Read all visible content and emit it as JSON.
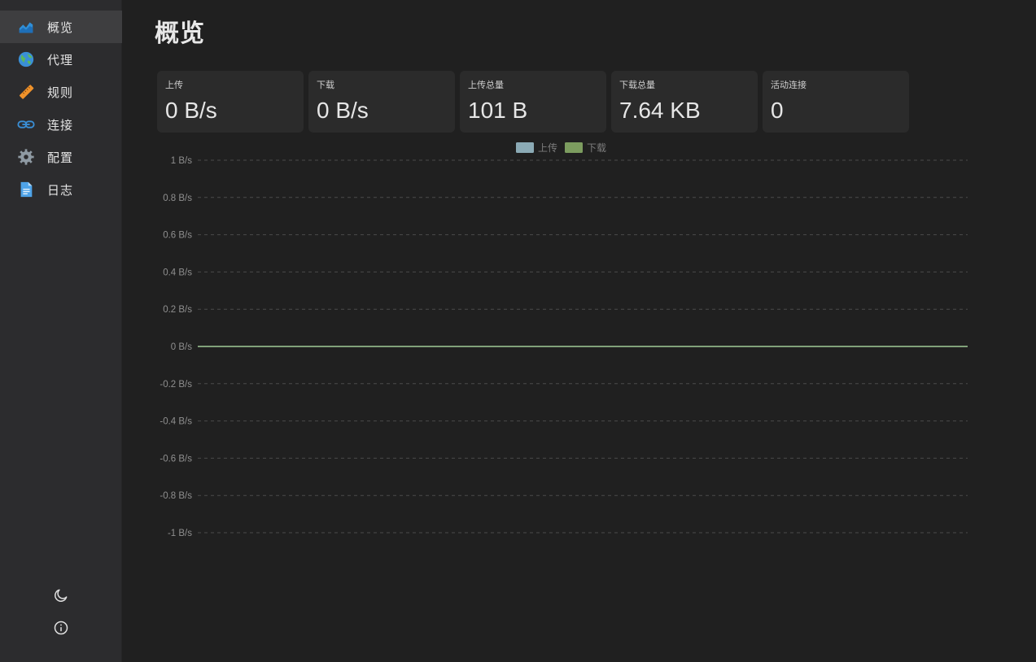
{
  "sidebar": {
    "items": [
      {
        "label": "概览",
        "icon": "chart-area-icon",
        "active": true
      },
      {
        "label": "代理",
        "icon": "globe-icon",
        "active": false
      },
      {
        "label": "规则",
        "icon": "ruler-icon",
        "active": false
      },
      {
        "label": "连接",
        "icon": "link-icon",
        "active": false
      },
      {
        "label": "配置",
        "icon": "gear-icon",
        "active": false
      },
      {
        "label": "日志",
        "icon": "document-icon",
        "active": false
      }
    ],
    "bottom": [
      {
        "icon": "moon-icon"
      },
      {
        "icon": "info-icon"
      }
    ]
  },
  "main": {
    "title": "概览",
    "stats": [
      {
        "label": "上传",
        "value": "0 B/s"
      },
      {
        "label": "下载",
        "value": "0 B/s"
      },
      {
        "label": "上传总量",
        "value": "101 B"
      },
      {
        "label": "下载总量",
        "value": "7.64 KB"
      },
      {
        "label": "活动连接",
        "value": "0"
      }
    ]
  },
  "chart_data": {
    "type": "line",
    "title": "",
    "xlabel": "",
    "ylabel": "",
    "ylim": [
      -1,
      1
    ],
    "yticks": [
      "1 B/s",
      "0.8 B/s",
      "0.6 B/s",
      "0.4 B/s",
      "0.2 B/s",
      "0 B/s",
      "-0.2 B/s",
      "-0.4 B/s",
      "-0.6 B/s",
      "-0.8 B/s",
      "-1 B/s"
    ],
    "ytick_values": [
      1,
      0.8,
      0.6,
      0.4,
      0.2,
      0,
      -0.2,
      -0.4,
      -0.6,
      -0.8,
      -1
    ],
    "grid": true,
    "legend_position": "top",
    "series": [
      {
        "name": "上传",
        "color": "#9fc3d0",
        "values": [
          0,
          0,
          0,
          0,
          0,
          0,
          0,
          0,
          0,
          0,
          0,
          0,
          0,
          0,
          0,
          0,
          0,
          0,
          0,
          0
        ]
      },
      {
        "name": "下载",
        "color": "#8db36b",
        "values": [
          0,
          0,
          0,
          0,
          0,
          0,
          0,
          0,
          0,
          0,
          0,
          0,
          0,
          0,
          0,
          0,
          0,
          0,
          0,
          0
        ]
      }
    ]
  },
  "colors": {
    "background": "#202020",
    "sidebar": "#2c2c2e",
    "card": "#2b2b2b",
    "upload": "#9fc3d0",
    "download": "#8db36b"
  }
}
